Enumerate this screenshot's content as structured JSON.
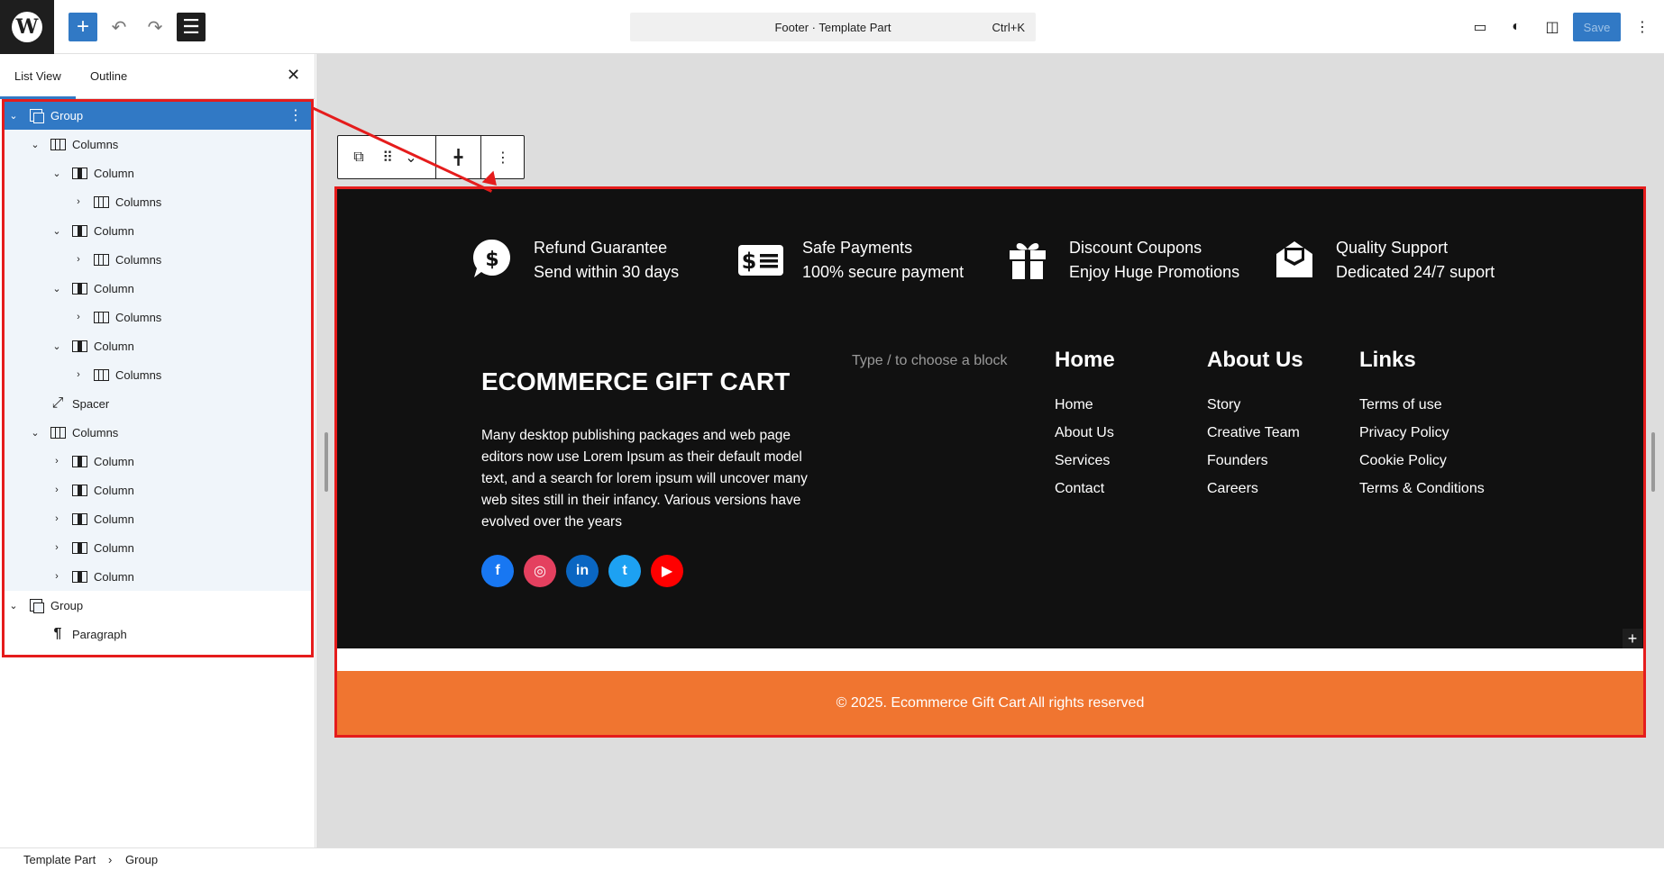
{
  "topbar": {
    "logo": "W",
    "add_icon": "+",
    "undo_icon": "↶",
    "redo_icon": "↷",
    "listview_icon": "☰",
    "command_title": "Footer · Template Part",
    "command_shortcut": "Ctrl+K",
    "view_icon": "▭",
    "styles_icon": "◐",
    "settings_icon": "◫",
    "save_label": "Save",
    "options_icon": "⋮"
  },
  "sidebar": {
    "tabs": [
      "List View",
      "Outline"
    ],
    "close_icon": "✕",
    "tree": [
      {
        "label": "Group",
        "chev": "⌄",
        "icon": "group"
      },
      {
        "label": "Columns",
        "chev": "⌄",
        "icon": "columns"
      },
      {
        "label": "Column",
        "chev": "⌄",
        "icon": "column"
      },
      {
        "label": "Columns",
        "chev": "›",
        "icon": "columns"
      },
      {
        "label": "Column",
        "chev": "⌄",
        "icon": "column"
      },
      {
        "label": "Columns",
        "chev": "›",
        "icon": "columns"
      },
      {
        "label": "Column",
        "chev": "⌄",
        "icon": "column"
      },
      {
        "label": "Columns",
        "chev": "›",
        "icon": "columns"
      },
      {
        "label": "Column",
        "chev": "⌄",
        "icon": "column"
      },
      {
        "label": "Columns",
        "chev": "›",
        "icon": "columns"
      },
      {
        "label": "Spacer",
        "chev": "",
        "icon": "spacer"
      },
      {
        "label": "Columns",
        "chev": "⌄",
        "icon": "columns"
      },
      {
        "label": "Column",
        "chev": "›",
        "icon": "column"
      },
      {
        "label": "Column",
        "chev": "›",
        "icon": "column"
      },
      {
        "label": "Column",
        "chev": "›",
        "icon": "column"
      },
      {
        "label": "Column",
        "chev": "›",
        "icon": "column"
      },
      {
        "label": "Column",
        "chev": "›",
        "icon": "column"
      },
      {
        "label": "Group",
        "chev": "⌄",
        "icon": "group"
      },
      {
        "label": "Paragraph",
        "chev": "",
        "icon": "paragraph"
      }
    ],
    "more_icon": "⋮"
  },
  "breadcrumb": {
    "items": [
      "Template Part",
      "Group"
    ],
    "sep": "›"
  },
  "block_toolbar": {
    "parent_icon": "⧉",
    "drag_icon": "⠿",
    "move_icon": "⌄",
    "align_icon": "╋",
    "more_icon": "⋮"
  },
  "footer": {
    "features": [
      {
        "icon": "refund-icon",
        "title": "Refund Guarantee",
        "sub": "Send within 30 days"
      },
      {
        "icon": "payment-icon",
        "title": "Safe Payments",
        "sub": "100% secure payment"
      },
      {
        "icon": "gift-icon",
        "title": "Discount Coupons",
        "sub": "Enjoy Huge Promotions"
      },
      {
        "icon": "support-icon",
        "title": "Quality Support",
        "sub": "Dedicated 24/7 suport"
      }
    ],
    "brand": "ECOMMERCE GIFT CART",
    "description": "Many desktop publishing packages and web page editors now use Lorem Ipsum as their default model text, and a search for lorem ipsum will uncover many web sites still in their infancy. Various versions have evolved over the years",
    "placeholder": "Type / to choose a block",
    "social": [
      {
        "name": "facebook",
        "glyph": "f",
        "color": "#1877f2"
      },
      {
        "name": "instagram",
        "glyph": "◎",
        "color": "#e4405f"
      },
      {
        "name": "linkedin",
        "glyph": "in",
        "color": "#0a66c2"
      },
      {
        "name": "twitter",
        "glyph": "t",
        "color": "#1da1f2"
      },
      {
        "name": "youtube",
        "glyph": "▶",
        "color": "#ff0000"
      }
    ],
    "nav": [
      {
        "heading": "Home",
        "links": [
          "Home",
          "About Us",
          "Services",
          "Contact"
        ]
      },
      {
        "heading": "About Us",
        "links": [
          "Story",
          "Creative Team",
          "Founders",
          "Careers"
        ]
      },
      {
        "heading": "Links",
        "links": [
          "Terms of use",
          "Privacy Policy",
          "Cookie Policy",
          "Terms & Conditions"
        ]
      }
    ],
    "copyright": "© 2025. Ecommerce Gift Cart All rights reserved",
    "plus_icon": "+"
  },
  "colors": {
    "accent": "#3179c5",
    "highlight": "#e51c1c",
    "footer_bg": "#111111",
    "copyright_bg": "#f07530"
  }
}
